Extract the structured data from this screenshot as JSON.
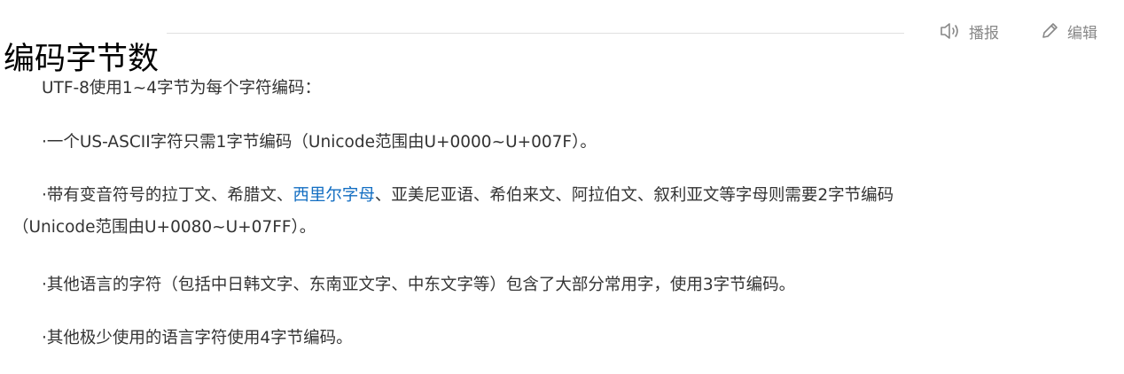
{
  "header": {
    "title": "编码字节数",
    "report_label": "播报",
    "edit_label": "编辑",
    "report_icon": "speaker-icon",
    "edit_icon": "pencil-icon"
  },
  "paragraphs": {
    "p1": "UTF-8使用1~4字节为每个字符编码：",
    "p2": "·一个US-ASCII字符只需1字节编码（Unicode范围由U+0000~U+007F）。",
    "p3_before": "·带有变音符号的拉丁文、希腊文、",
    "p3_link": "西里尔字母",
    "p3_after": "、亚美尼亚语、希伯来文、阿拉伯文、叙利亚文等字母则需要2字节编码",
    "p3_line2": "（Unicode范围由U+0080~U+07FF）。",
    "p4": "·其他语言的字符（包括中日韩文字、东南亚文字、中东文字等）包含了大部分常用字，使用3字节编码。",
    "p5": "·其他极少使用的语言字符使用4字节编码。"
  },
  "colors": {
    "link": "#136ec2",
    "text": "#333333",
    "tool": "#888888",
    "rule": "#e0e0e0"
  }
}
